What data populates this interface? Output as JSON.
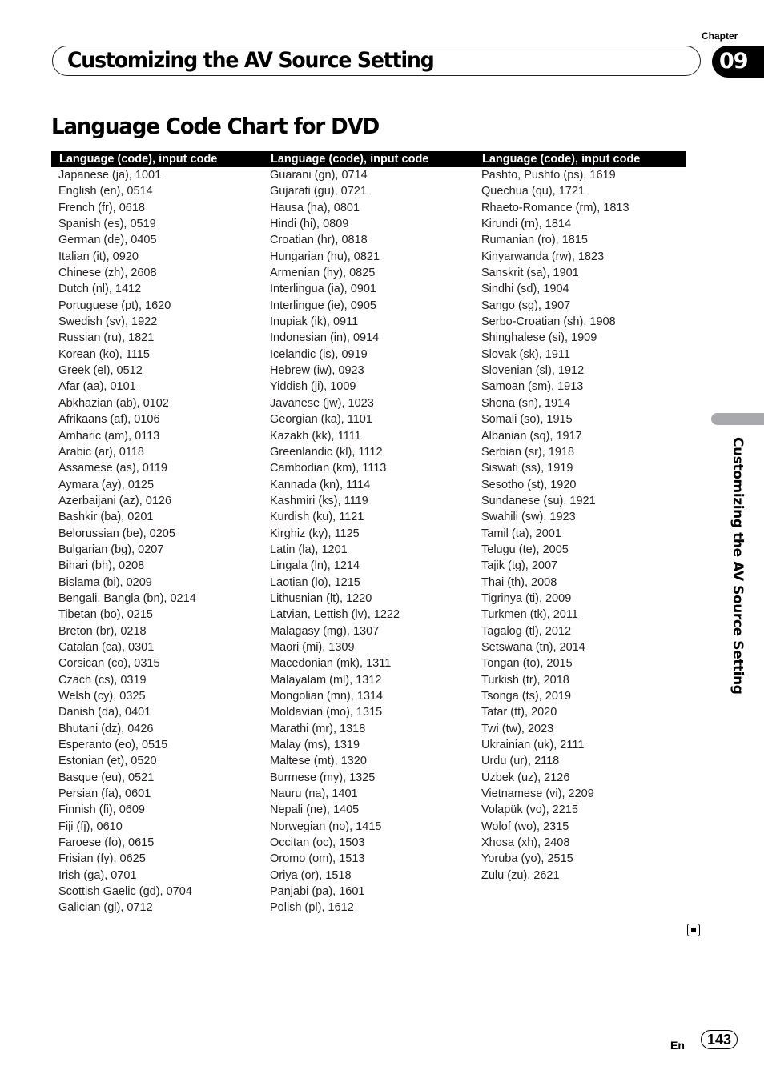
{
  "header": {
    "chapter_label": "Chapter",
    "chapter_number": "09",
    "section_title": "Customizing the AV Source Setting"
  },
  "page_title": "Language Code Chart for DVD",
  "table": {
    "columns": [
      {
        "header": "Language (code), input code",
        "rows": [
          "Japanese (ja), 1001",
          "English (en), 0514",
          "French (fr), 0618",
          "Spanish (es), 0519",
          "German (de), 0405",
          "Italian (it), 0920",
          "Chinese (zh), 2608",
          "Dutch (nl), 1412",
          "Portuguese (pt), 1620",
          "Swedish (sv), 1922",
          "Russian (ru), 1821",
          "Korean (ko), 1115",
          "Greek (el), 0512",
          "Afar (aa), 0101",
          "Abkhazian (ab), 0102",
          "Afrikaans (af), 0106",
          "Amharic (am), 0113",
          "Arabic (ar), 0118",
          "Assamese (as), 0119",
          "Aymara (ay), 0125",
          "Azerbaijani (az), 0126",
          "Bashkir (ba), 0201",
          "Belorussian (be), 0205",
          "Bulgarian (bg), 0207",
          "Bihari (bh), 0208",
          "Bislama (bi), 0209",
          "Bengali, Bangla (bn), 0214",
          "Tibetan (bo), 0215",
          "Breton (br), 0218",
          "Catalan (ca), 0301",
          "Corsican (co), 0315",
          "Czach (cs), 0319",
          "Welsh (cy), 0325",
          "Danish (da), 0401",
          "Bhutani (dz), 0426",
          "Esperanto (eo), 0515",
          "Estonian (et), 0520",
          "Basque (eu), 0521",
          "Persian (fa), 0601",
          "Finnish (fi), 0609",
          "Fiji (fj), 0610",
          "Faroese (fo), 0615",
          "Frisian (fy), 0625",
          "Irish (ga), 0701",
          "Scottish Gaelic (gd), 0704",
          "Galician (gl), 0712"
        ]
      },
      {
        "header": "Language (code), input code",
        "rows": [
          "Guarani (gn), 0714",
          "Gujarati (gu), 0721",
          "Hausa (ha), 0801",
          "Hindi (hi), 0809",
          "Croatian (hr), 0818",
          "Hungarian (hu), 0821",
          "Armenian (hy), 0825",
          "Interlingua (ia), 0901",
          "Interlingue (ie), 0905",
          "Inupiak (ik), 0911",
          "Indonesian (in), 0914",
          "Icelandic (is), 0919",
          "Hebrew (iw), 0923",
          "Yiddish (ji), 1009",
          "Javanese (jw), 1023",
          "Georgian (ka), 1101",
          "Kazakh (kk), 1111",
          "Greenlandic (kl), 1112",
          "Cambodian (km), 1113",
          "Kannada (kn), 1114",
          "Kashmiri (ks), 1119",
          "Kurdish (ku), 1121",
          "Kirghiz (ky), 1125",
          "Latin (la), 1201",
          "Lingala (ln), 1214",
          "Laotian (lo), 1215",
          "Lithusnian (lt), 1220",
          "Latvian, Lettish (lv), 1222",
          "Malagasy (mg), 1307",
          "Maori (mi), 1309",
          "Macedonian (mk), 1311",
          "Malayalam (ml), 1312",
          "Mongolian (mn), 1314",
          "Moldavian (mo), 1315",
          "Marathi (mr), 1318",
          "Malay (ms), 1319",
          "Maltese (mt), 1320",
          "Burmese (my), 1325",
          "Nauru (na), 1401",
          "Nepali (ne), 1405",
          "Norwegian (no), 1415",
          "Occitan (oc), 1503",
          "Oromo (om), 1513",
          "Oriya (or), 1518",
          "Panjabi (pa), 1601",
          "Polish (pl), 1612"
        ]
      },
      {
        "header": "Language (code), input code",
        "rows": [
          "Pashto, Pushto (ps), 1619",
          "Quechua (qu), 1721",
          "Rhaeto-Romance (rm), 1813",
          "Kirundi (rn), 1814",
          "Rumanian (ro), 1815",
          "Kinyarwanda (rw), 1823",
          "Sanskrit (sa), 1901",
          "Sindhi (sd), 1904",
          "Sango (sg), 1907",
          "Serbo-Croatian (sh), 1908",
          "Shinghalese (si), 1909",
          "Slovak (sk), 1911",
          "Slovenian (sl), 1912",
          "Samoan (sm), 1913",
          "Shona (sn), 1914",
          "Somali (so), 1915",
          "Albanian (sq), 1917",
          "Serbian (sr), 1918",
          "Siswati (ss), 1919",
          "Sesotho (st), 1920",
          "Sundanese (su), 1921",
          "Swahili (sw), 1923",
          "Tamil (ta), 2001",
          "Telugu (te), 2005",
          "Tajik (tg), 2007",
          "Thai (th), 2008",
          "Tigrinya (ti), 2009",
          "Turkmen (tk), 2011",
          "Tagalog (tl), 2012",
          "Setswana (tn), 2014",
          "Tongan (to), 2015",
          "Turkish (tr), 2018",
          "Tsonga (ts), 2019",
          "Tatar (tt), 2020",
          "Twi (tw), 2023",
          "Ukrainian (uk), 2111",
          "Urdu (ur), 2118",
          "Uzbek (uz), 2126",
          "Vietnamese (vi), 2209",
          "Volapük (vo), 2215",
          "Wolof (wo), 2315",
          "Xhosa (xh), 2408",
          "Yoruba (yo), 2515",
          "Zulu (zu), 2621"
        ]
      }
    ]
  },
  "side_tab": {
    "label": "Customizing the AV Source Setting"
  },
  "end_mark_icon": "end-of-section-icon",
  "footer": {
    "language": "En",
    "page_number": "143"
  }
}
